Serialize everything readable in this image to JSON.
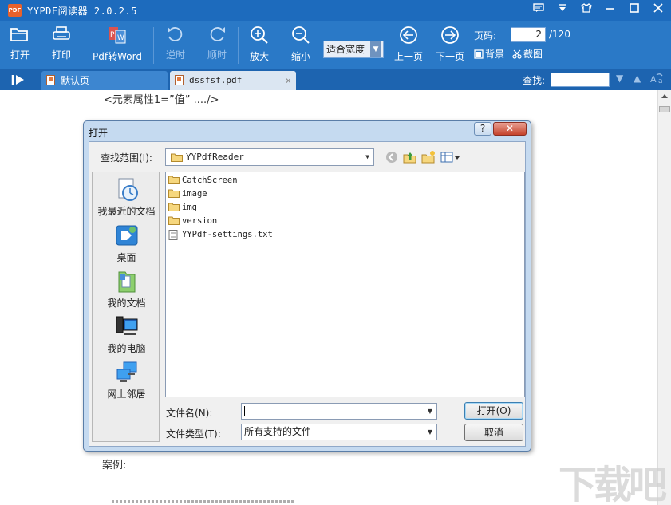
{
  "app": {
    "logo_text": "PDF",
    "title": "YYPDF阅读器 2.0.2.5"
  },
  "window_controls": [
    "feedback-icon",
    "dropdown-icon",
    "skin-icon",
    "minimize-icon",
    "maximize-icon",
    "close-icon"
  ],
  "toolbar": {
    "open": "打开",
    "print": "打印",
    "pdf_to_word": "Pdf转Word",
    "rotate_ccw": "逆时",
    "rotate_cw": "顺时",
    "zoom_in": "放大",
    "zoom_out": "缩小",
    "zoom_mode": "适合宽度",
    "prev_page": "上一页",
    "next_page": "下一页",
    "page_label": "页码:",
    "page_current": "2",
    "page_total": "/120",
    "background": "背景",
    "screenshot": "截图"
  },
  "tabs": [
    {
      "label": "默认页",
      "active": false
    },
    {
      "label": "dssfsf.pdf",
      "active": true,
      "close": "×"
    }
  ],
  "find": {
    "label": "查找:",
    "value": ""
  },
  "document": {
    "line1": "<元素属性1=”值”  ..../>",
    "line2": "案例:"
  },
  "dialog": {
    "title": "打开",
    "help": "?",
    "close": "✕",
    "look_in_label": "查找范围(I):",
    "look_in_value": "YYPdfReader",
    "places": [
      {
        "label": "我最近的文档",
        "icon": "recent-documents-icon"
      },
      {
        "label": "桌面",
        "icon": "desktop-icon"
      },
      {
        "label": "我的文档",
        "icon": "my-documents-icon"
      },
      {
        "label": "我的电脑",
        "icon": "my-computer-icon"
      },
      {
        "label": "网上邻居",
        "icon": "network-places-icon"
      }
    ],
    "files": [
      {
        "name": "CatchScreen",
        "type": "folder"
      },
      {
        "name": "image",
        "type": "folder"
      },
      {
        "name": "img",
        "type": "folder"
      },
      {
        "name": "version",
        "type": "folder"
      },
      {
        "name": "YYPdf-settings.txt",
        "type": "text"
      }
    ],
    "filename_label": "文件名(N):",
    "filename_value": "",
    "filetype_label": "文件类型(T):",
    "filetype_value": "所有支持的文件",
    "open_button": "打开(O)",
    "cancel_button": "取消"
  },
  "watermark": "下载吧",
  "colors": {
    "titlebar": "#1d6bbd",
    "toolbar": "#2a79c7",
    "tabbar": "#1d64b0",
    "dialog_frame": "#c5daf0"
  }
}
